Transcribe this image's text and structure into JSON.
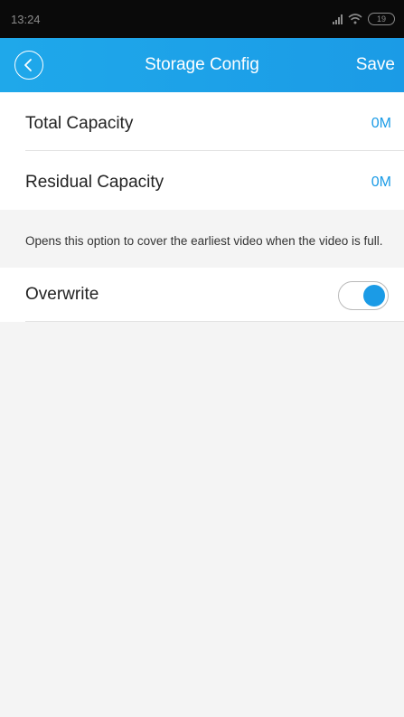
{
  "status_bar": {
    "time": "13:24",
    "battery": "19",
    "icons": [
      "signal-icon",
      "wifi-icon",
      "battery-icon"
    ]
  },
  "navbar": {
    "title": "Storage Config",
    "save_label": "Save",
    "back_icon": "chevron-left-circle-icon",
    "color": "#1b9be6"
  },
  "capacity": {
    "total_label": "Total Capacity",
    "total_value": "0M",
    "residual_label": "Residual Capacity",
    "residual_value": "0M"
  },
  "overwrite": {
    "hint": "Opens this option to cover the earliest video when the video is full.",
    "label": "Overwrite",
    "enabled": true
  }
}
